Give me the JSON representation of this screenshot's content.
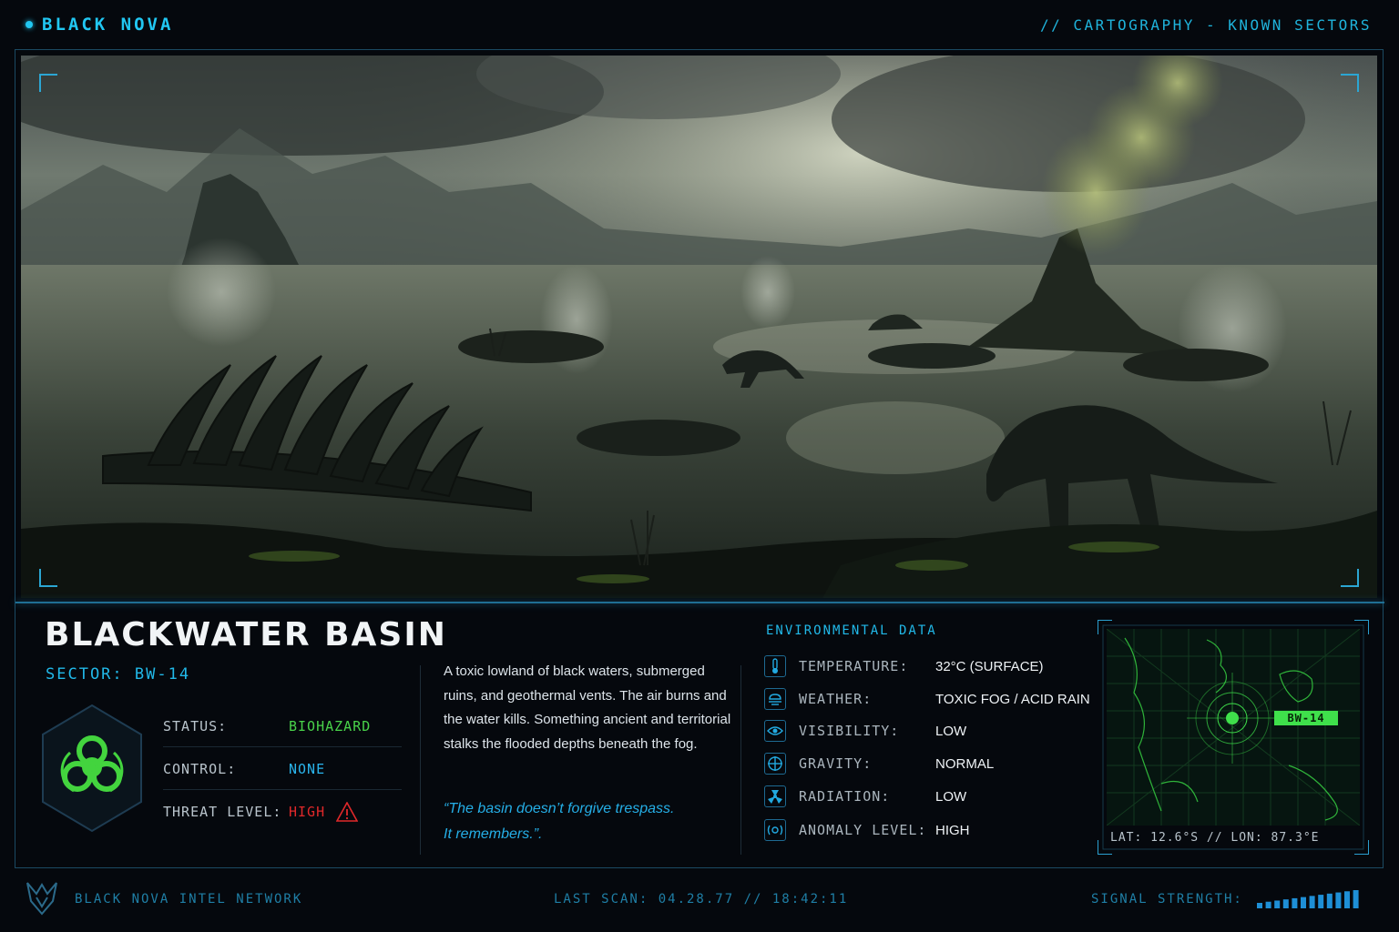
{
  "header": {
    "brand": "BLACK NOVA",
    "breadcrumb": "//  CARTOGRAPHY - KNOWN SECTORS"
  },
  "location": {
    "title": "BLACKWATER BASIN",
    "sector": "SECTOR: BW-14",
    "status_icon": "biohazard-icon",
    "stats": [
      {
        "label": "STATUS:",
        "value": "BIOHAZARD",
        "color": "#49d24a"
      },
      {
        "label": "CONTROL:",
        "value": "NONE",
        "color": "#2ab4ec"
      },
      {
        "label": "THREAT LEVEL:",
        "value": "HIGH",
        "color": "#e0282a",
        "icon": "warning-icon"
      }
    ],
    "description": "A toxic lowland of black waters, submerged ruins, and geothermal vents. The air burns and the water kills. Something ancient and territorial stalks the flooded depths beneath the fog.",
    "quote_line1": "“The basin doesn’t forgive trespass.",
    "quote_line2": "It remembers.”."
  },
  "environment": {
    "title": "ENVIRONMENTAL DATA",
    "rows": [
      {
        "icon": "thermometer-icon",
        "label": "TEMPERATURE:",
        "value": "32°C (SURFACE)"
      },
      {
        "icon": "weather-icon",
        "label": "WEATHER:",
        "value": "TOXIC FOG / ACID RAIN"
      },
      {
        "icon": "eye-icon",
        "label": "VISIBILITY:",
        "value": "LOW"
      },
      {
        "icon": "gravity-icon",
        "label": "GRAVITY:",
        "value": "NORMAL"
      },
      {
        "icon": "radiation-icon",
        "label": "RADIATION:",
        "value": "LOW"
      },
      {
        "icon": "anomaly-icon",
        "label": "ANOMALY LEVEL:",
        "value": "HIGH"
      }
    ]
  },
  "map": {
    "marker": "BW-14",
    "coords": "LAT: 12.6°S  // LON: 87.3°E"
  },
  "footer": {
    "network": "BLACK NOVA INTEL NETWORK",
    "last_scan": "LAST SCAN: 04.28.77 // 18:42:11",
    "signal_label": "SIGNAL STRENGTH:",
    "signal_bars_total": 12,
    "signal_bars_active": 12
  },
  "colors": {
    "accent": "#21c7f2",
    "biohazard": "#49d24a",
    "danger": "#e0282a"
  }
}
